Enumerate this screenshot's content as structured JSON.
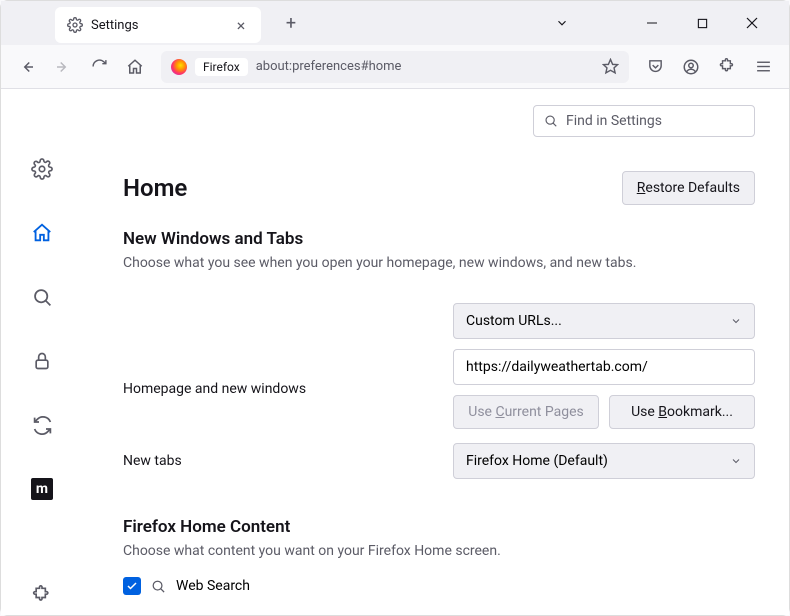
{
  "tab": {
    "title": "Settings"
  },
  "url": {
    "brand": "Firefox",
    "path": "about:preferences#home"
  },
  "search": {
    "placeholder": "Find in Settings"
  },
  "page": {
    "title": "Home",
    "restore_btn": "Restore Defaults"
  },
  "section1": {
    "title": "New Windows and Tabs",
    "desc": "Choose what you see when you open your homepage, new windows, and new tabs.",
    "homepage_label": "Homepage and new windows",
    "homepage_select": "Custom URLs...",
    "homepage_url": "https://dailyweathertab.com/",
    "use_current": "Use Current Pages",
    "use_bookmark": "Use Bookmark...",
    "newtabs_label": "New tabs",
    "newtabs_select": "Firefox Home (Default)"
  },
  "section2": {
    "title": "Firefox Home Content",
    "desc": "Choose what content you want on your Firefox Home screen.",
    "web_search": "Web Search"
  }
}
